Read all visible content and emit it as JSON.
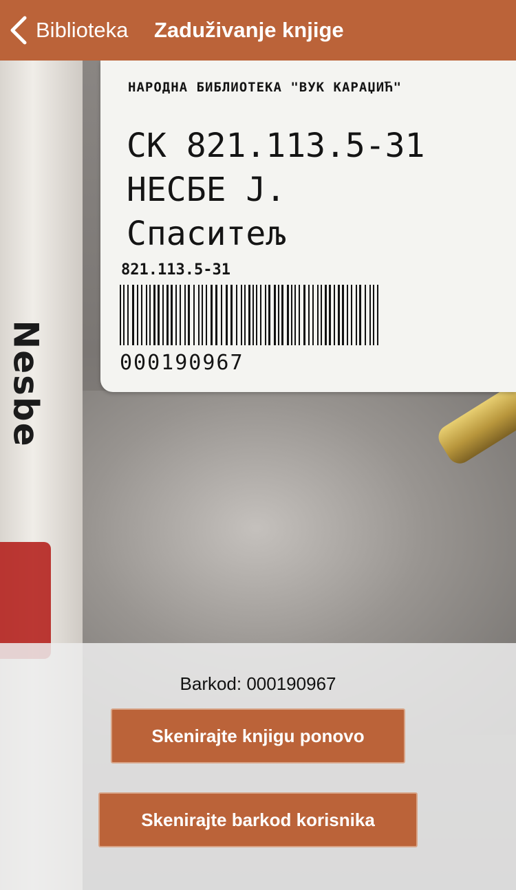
{
  "navbar": {
    "back_label": "Biblioteka",
    "title": "Zaduživanje knjige",
    "background": "#bb6339",
    "back_icon": "chevron-left-icon"
  },
  "photo": {
    "spine_text": "Nesbe",
    "sticker": {
      "library": "НАРОДНА БИБЛИОТЕКА \"ВУК КАРАЏИЋ\"",
      "call_number": "CK 821.113.5-31",
      "author": "НЕСБЕ J.",
      "title": "Спаситељ",
      "classification": "821.113.5-31",
      "barcode_number": "000190967"
    }
  },
  "panel": {
    "barcode_text": "Barkod: 000190967",
    "rescan_book_label": "Skenirajte knjigu ponovo",
    "scan_user_label": "Skenirajte barkod korisnika",
    "button_color": "#bb6339"
  }
}
